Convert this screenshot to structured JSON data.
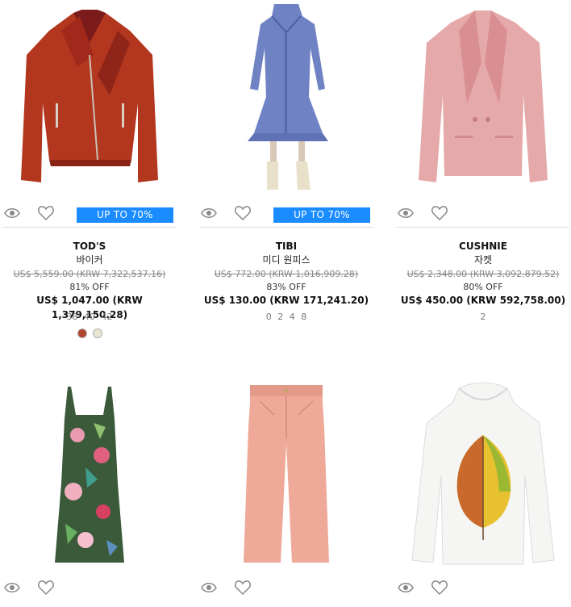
{
  "products": [
    {
      "brand": "TOD'S",
      "category": "바이커",
      "original_price": "US$ 5,559.00 (KRW 7,322,537.16)",
      "discount": "81% OFF",
      "price": "US$ 1,047.00 (KRW 1,379,150.28)",
      "sizes": "38 40 42",
      "badge": "UP TO 70%",
      "swatch_colors": [
        "#b3442e",
        "#e8e6d2"
      ],
      "image": "red-leather-biker-jacket"
    },
    {
      "brand": "TIBI",
      "category": "미디 원피스",
      "original_price": "US$ 772.00 (KRW 1,016,909.28)",
      "discount": "83% OFF",
      "price": "US$ 130.00 (KRW 171,241.20)",
      "sizes": "0 2 4 8",
      "badge": "UP TO 70%",
      "image": "blue-midi-dress"
    },
    {
      "brand": "CUSHNIE",
      "category": "자켓",
      "original_price": "US$ 2,348.00 (KRW 3,092,879.52)",
      "discount": "80% OFF",
      "price": "US$ 450.00 (KRW 592,758.00)",
      "sizes": "2",
      "image": "pink-satin-blazer"
    },
    {
      "image": "floral-wrap-dress"
    },
    {
      "image": "pink-wide-leg-jeans"
    },
    {
      "image": "white-leaf-print-hoodie"
    }
  ],
  "icons": {
    "view": "eye-icon",
    "wishlist": "heart-icon"
  },
  "colors": {
    "badge": "#1a8cff",
    "divider": "#d9d9d9",
    "strike": "#888888"
  }
}
